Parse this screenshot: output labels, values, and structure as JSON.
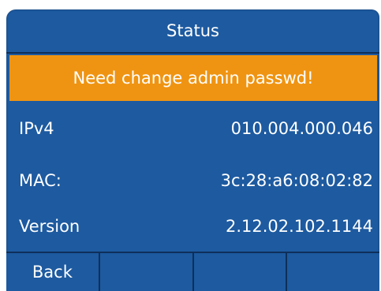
{
  "header": {
    "title": "Status"
  },
  "warning": {
    "text": "Need change admin passwd!"
  },
  "info": {
    "ipv4": {
      "label": "IPv4",
      "value": "010.004.000.046"
    },
    "mac": {
      "label": "MAC:",
      "value": "3c:28:a6:08:02:82"
    },
    "version": {
      "label": "Version",
      "value": "2.12.02.102.1144"
    }
  },
  "softkeys": [
    "Back",
    "",
    "",
    ""
  ],
  "colors": {
    "background": "#1d5aa0",
    "banner": "#ef9412",
    "divider": "#0e2f5a",
    "text": "#ffffff"
  }
}
